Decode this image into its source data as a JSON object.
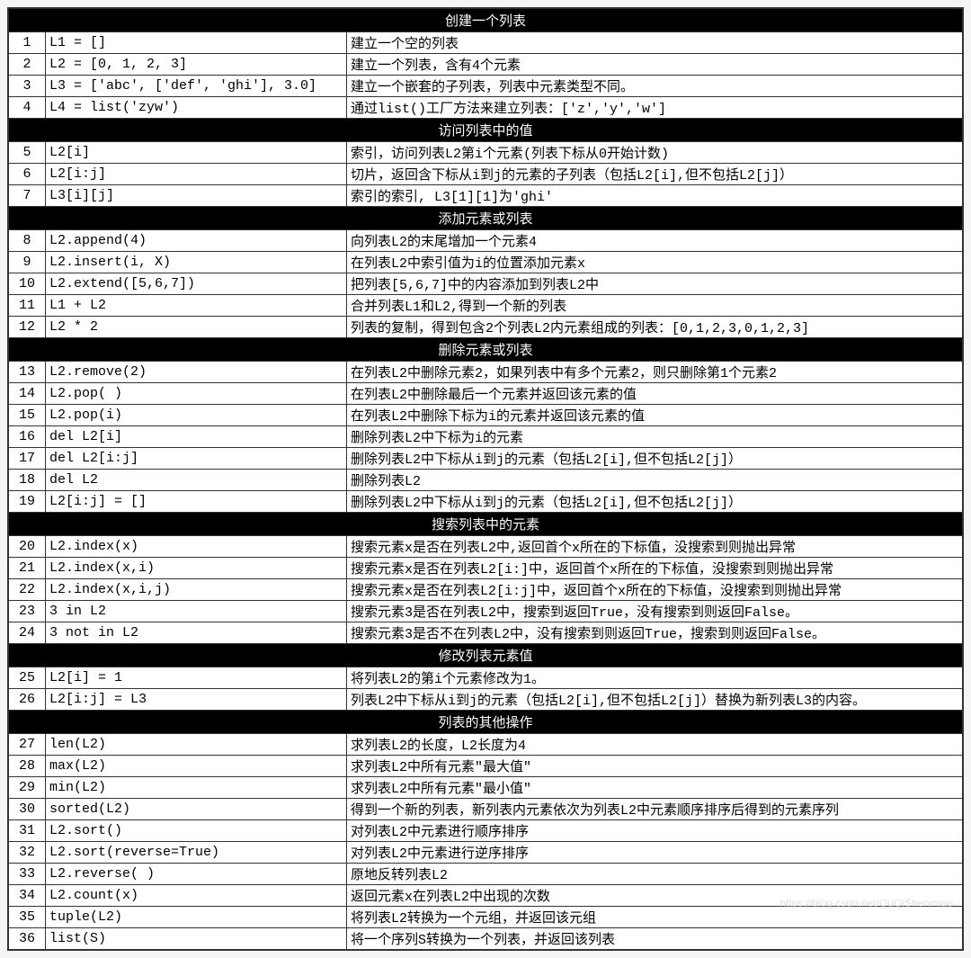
{
  "sections": [
    {
      "title": "创建一个列表",
      "rows": [
        {
          "n": "1",
          "code": "L1 = []",
          "desc": "建立一个空的列表"
        },
        {
          "n": "2",
          "code": "L2 = [0, 1, 2, 3]",
          "desc": "建立一个列表，含有4个元素"
        },
        {
          "n": "3",
          "code": "L3 = ['abc', ['def', 'ghi'], 3.0]",
          "desc": "建立一个嵌套的子列表，列表中元素类型不同。"
        },
        {
          "n": "4",
          "code": "L4 = list('zyw')",
          "desc": "通过list()工厂方法来建立列表：['z','y','w']"
        }
      ]
    },
    {
      "title": "访问列表中的值",
      "rows": [
        {
          "n": "5",
          "code": "L2[i]",
          "desc": "索引，访问列表L2第i个元素(列表下标从0开始计数)"
        },
        {
          "n": "6",
          "code": "L2[i:j]",
          "desc": "切片，返回含下标从i到j的元素的子列表（包括L2[i],但不包括L2[j]）"
        },
        {
          "n": "7",
          "code": "L3[i][j]",
          "desc": "索引的索引, L3[1][1]为'ghi'"
        }
      ]
    },
    {
      "title": "添加元素或列表",
      "rows": [
        {
          "n": "8",
          "code": "L2.append(4)",
          "desc": "向列表L2的末尾增加一个元素4"
        },
        {
          "n": "9",
          "code": "L2.insert(i, X)",
          "desc": "在列表L2中索引值为i的位置添加元素x"
        },
        {
          "n": "10",
          "code": "L2.extend([5,6,7])",
          "desc": "把列表[5,6,7]中的内容添加到列表L2中"
        },
        {
          "n": "11",
          "code": "L1 + L2",
          "desc": "合并列表L1和L2,得到一个新的列表"
        },
        {
          "n": "12",
          "code": "L2 * 2",
          "desc": "列表的复制，得到包含2个列表L2内元素组成的列表：[0,1,2,3,0,1,2,3]"
        }
      ]
    },
    {
      "title": "删除元素或列表",
      "rows": [
        {
          "n": "13",
          "code": "L2.remove(2)",
          "desc": "在列表L2中删除元素2，如果列表中有多个元素2，则只删除第1个元素2"
        },
        {
          "n": "14",
          "code": "L2.pop( )",
          "desc": "在列表L2中删除最后一个元素并返回该元素的值"
        },
        {
          "n": "15",
          "code": "L2.pop(i)",
          "desc": "在列表L2中删除下标为i的元素并返回该元素的值"
        },
        {
          "n": "16",
          "code": "del L2[i]",
          "desc": "删除列表L2中下标为i的元素"
        },
        {
          "n": "17",
          "code": "del L2[i:j]",
          "desc": "删除列表L2中下标从i到j的元素（包括L2[i],但不包括L2[j]）"
        },
        {
          "n": "18",
          "code": "del L2",
          "desc": "删除列表L2"
        },
        {
          "n": "19",
          "code": "L2[i:j] = []",
          "desc": "删除列表L2中下标从i到j的元素（包括L2[i],但不包括L2[j]）"
        }
      ]
    },
    {
      "title": "搜索列表中的元素",
      "rows": [
        {
          "n": "20",
          "code": "L2.index(x)",
          "desc": "搜索元素x是否在列表L2中,返回首个x所在的下标值，没搜索到则抛出异常"
        },
        {
          "n": "21",
          "code": "L2.index(x,i)",
          "desc": "搜索元素x是否在列表L2[i:]中，返回首个x所在的下标值，没搜索到则抛出异常"
        },
        {
          "n": "22",
          "code": "L2.index(x,i,j)",
          "desc": "搜索元素x是否在列表L2[i:j]中，返回首个x所在的下标值，没搜索到则抛出异常"
        },
        {
          "n": "23",
          "code": "3 in L2",
          "desc": "搜索元素3是否在列表L2中，搜索到返回True，没有搜索到则返回False。"
        },
        {
          "n": "24",
          "code": "3 not in L2",
          "desc": "搜索元素3是否不在列表L2中，没有搜索到则返回True，搜索到则返回False。"
        }
      ]
    },
    {
      "title": "修改列表元素值",
      "rows": [
        {
          "n": "25",
          "code": "L2[i] = 1",
          "desc": "将列表L2的第i个元素修改为1。"
        },
        {
          "n": "26",
          "code": "L2[i:j] = L3",
          "desc": "列表L2中下标从i到j的元素（包括L2[i],但不包括L2[j]）替换为新列表L3的内容。"
        }
      ]
    },
    {
      "title": "列表的其他操作",
      "rows": [
        {
          "n": "27",
          "code": "len(L2)",
          "desc": "求列表L2的长度，L2长度为4"
        },
        {
          "n": "28",
          "code": "max(L2)",
          "desc": "求列表L2中所有元素\"最大值\""
        },
        {
          "n": "29",
          "code": "min(L2)",
          "desc": "求列表L2中所有元素\"最小值\""
        },
        {
          "n": "30",
          "code": "sorted(L2)",
          "desc": "得到一个新的列表，新列表内元素依次为列表L2中元素顺序排序后得到的元素序列"
        },
        {
          "n": "31",
          "code": "L2.sort()",
          "desc": "对列表L2中元素进行顺序排序"
        },
        {
          "n": "32",
          "code": "L2.sort(reverse=True)",
          "desc": "对列表L2中元素进行逆序排序"
        },
        {
          "n": "33",
          "code": "L2.reverse( )",
          "desc": "原地反转列表L2"
        },
        {
          "n": "34",
          "code": "L2.count(x)",
          "desc": "返回元素x在列表L2中出现的次数"
        },
        {
          "n": "35",
          "code": "tuple(L2)",
          "desc": "将列表L2转换为一个元组，并返回该元组"
        },
        {
          "n": "36",
          "code": "list(S)",
          "desc": "将一个序列S转换为一个列表，并返回该列表"
        }
      ]
    }
  ],
  "watermark": "https://blog.csdn.net/QuQiShenmiao"
}
